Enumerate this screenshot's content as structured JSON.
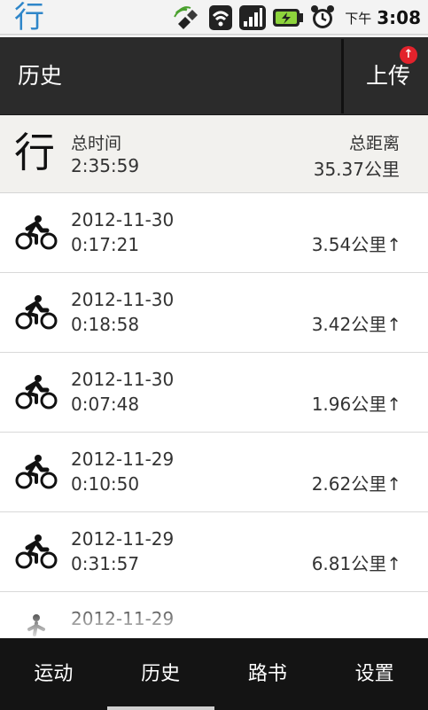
{
  "statusbar": {
    "app_glyph": "行",
    "icons": [
      "satellite-icon",
      "wifi-icon",
      "signal-icon",
      "battery-charging-icon",
      "alarm-icon"
    ],
    "ampm": "下午",
    "time": "3:08"
  },
  "titlebar": {
    "title": "历史",
    "upload_label": "上传",
    "upload_badge": "↑"
  },
  "summary": {
    "glyph": "行",
    "total_time_label": "总时间",
    "total_time": "2:35:59",
    "total_distance_label": "总距离",
    "total_distance": "35.37公里"
  },
  "records": [
    {
      "icon": "bicycle-icon",
      "date": "2012-11-30",
      "duration": "0:17:21",
      "distance": "3.54公里↑"
    },
    {
      "icon": "bicycle-icon",
      "date": "2012-11-30",
      "duration": "0:18:58",
      "distance": "3.42公里↑"
    },
    {
      "icon": "bicycle-icon",
      "date": "2012-11-30",
      "duration": "0:07:48",
      "distance": "1.96公里↑"
    },
    {
      "icon": "bicycle-icon",
      "date": "2012-11-29",
      "duration": "0:10:50",
      "distance": "2.62公里↑"
    },
    {
      "icon": "bicycle-icon",
      "date": "2012-11-29",
      "duration": "0:31:57",
      "distance": "6.81公里↑"
    },
    {
      "icon": "running-icon",
      "date": "2012-11-29",
      "duration": "",
      "distance": ""
    }
  ],
  "bottomnav": {
    "tabs": [
      {
        "label": "运动"
      },
      {
        "label": "历史",
        "active": true
      },
      {
        "label": "路书"
      },
      {
        "label": "设置"
      }
    ]
  },
  "colors": {
    "app_blue": "#2f86c9",
    "titlebar_bg": "#2b2b2b",
    "summary_bg": "#f2f1ee",
    "badge_red": "#e3222c",
    "nav_bg": "#141414"
  }
}
